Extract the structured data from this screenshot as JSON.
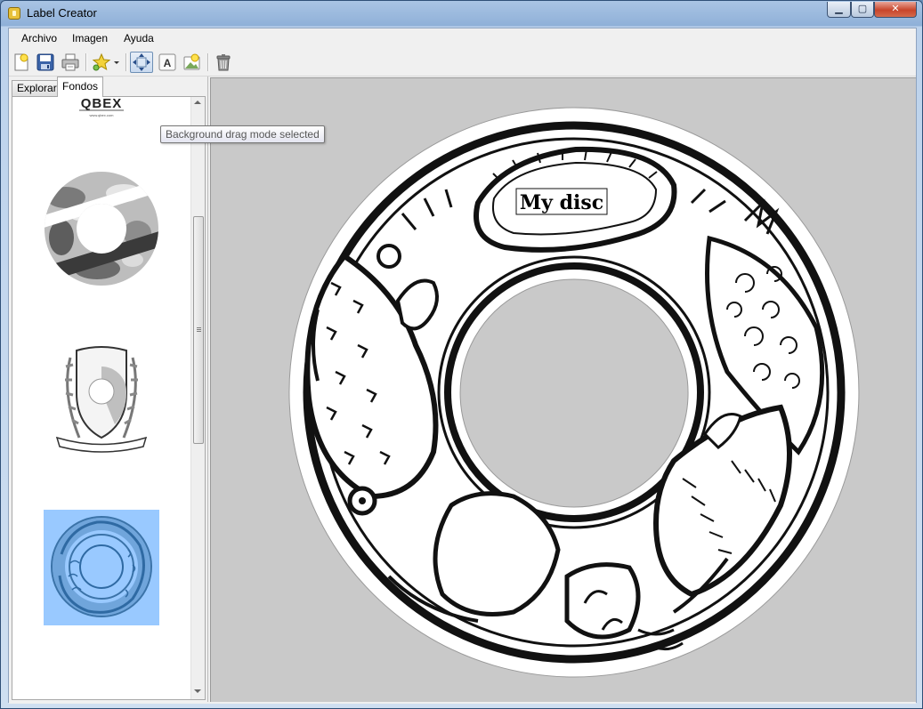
{
  "window": {
    "title": "Label Creator",
    "controls": {
      "minimize": "▁",
      "maximize": "▢",
      "close": "✕"
    }
  },
  "menu": [
    {
      "label": "Archivo"
    },
    {
      "label": "Imagen"
    },
    {
      "label": "Ayuda"
    }
  ],
  "toolbar": {
    "buttons": [
      {
        "icon": "new-document-icon"
      },
      {
        "icon": "save-icon"
      },
      {
        "icon": "print-icon"
      },
      {
        "icon": "add-star-icon"
      },
      {
        "icon": "dropdown-arrow-icon"
      },
      {
        "icon": "drag-background-icon",
        "active": true
      },
      {
        "icon": "text-tool-icon"
      },
      {
        "icon": "add-image-icon"
      },
      {
        "icon": "trash-icon"
      }
    ],
    "tooltip": "Background drag mode selected"
  },
  "tabs": [
    {
      "label": "Explorar",
      "active": false
    },
    {
      "label": "Fondos",
      "active": true
    }
  ],
  "backgrounds": {
    "items": [
      {
        "name": "QBEX"
      },
      {
        "name": "camouflage-disc"
      },
      {
        "name": "shield-crest"
      },
      {
        "name": "dragon-ring",
        "selected": true
      }
    ],
    "selected_color": "#99c9ff"
  },
  "canvas": {
    "disc_text": "My disc",
    "background_color": "#c9c9c9"
  },
  "colors": {
    "titlebar": "#a9c4e4",
    "close_button": "#c8452b",
    "selection": "#99c9ff"
  }
}
